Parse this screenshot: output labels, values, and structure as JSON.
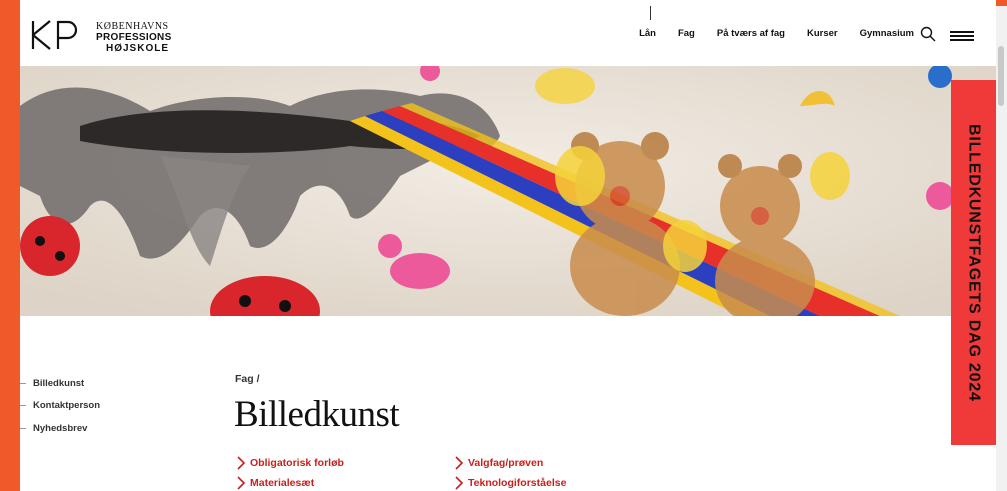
{
  "logo": {
    "line1": "KØBENHAVNS",
    "line2": "PROFESSIONS",
    "line3": "HØJSKOLE",
    "icon": "kp-logo-icon"
  },
  "nav": {
    "items": [
      "Lån",
      "Fag",
      "På tværs af fag",
      "Kurser",
      "Gymnasium"
    ],
    "search_icon": "search-icon",
    "menu_icon": "hamburger-menu-icon"
  },
  "banner": {
    "text": "BILLEDKUNSTFAGETS DAG 2024",
    "color": "#f03a3a"
  },
  "sidebar": {
    "items": [
      "Billedkunst",
      "Kontaktperson",
      "Nyhedsbrev"
    ]
  },
  "breadcrumb": {
    "text": "Fag /"
  },
  "page": {
    "title": "Billedkunst"
  },
  "links": [
    {
      "label": "Obligatorisk forløb"
    },
    {
      "label": "Valgfag/prøven"
    },
    {
      "label": "Materialesæt"
    },
    {
      "label": "Teknologiforståelse"
    }
  ],
  "colors": {
    "brand_orange": "#f05a28",
    "link_red": "#c8201c"
  }
}
